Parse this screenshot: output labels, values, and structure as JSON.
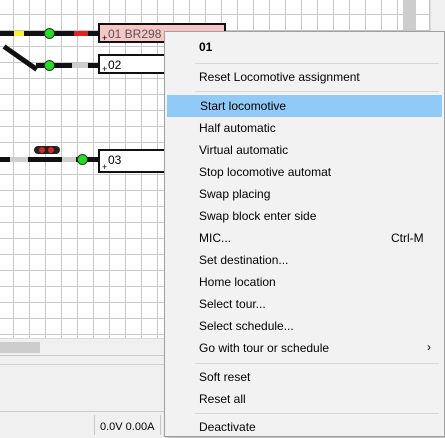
{
  "blocks": [
    {
      "id": "01",
      "label": "01 BR298",
      "plus": "+"
    },
    {
      "id": "02",
      "label": "02",
      "plus": "+"
    },
    {
      "id": "03",
      "label": "03",
      "plus": "+"
    }
  ],
  "status": {
    "voltage": "0.0V 0.00A"
  },
  "context_menu": {
    "header": "01",
    "items": [
      {
        "label": "Reset Locomotive assignment"
      },
      {
        "label": "Start locomotive",
        "highlighted": true
      },
      {
        "label": "Half automatic"
      },
      {
        "label": "Virtual automatic"
      },
      {
        "label": "Stop locomotive automat"
      },
      {
        "label": "Swap placing"
      },
      {
        "label": "Swap block enter side"
      },
      {
        "label": "MIC...",
        "shortcut": "Ctrl-M"
      },
      {
        "label": "Set destination..."
      },
      {
        "label": "Home location"
      },
      {
        "label": "Select tour..."
      },
      {
        "label": "Select schedule..."
      },
      {
        "label": "Go with tour or schedule",
        "submenu": "›"
      },
      {
        "label": "Soft reset"
      },
      {
        "label": "Reset all"
      },
      {
        "label": "Deactivate"
      }
    ]
  },
  "colors": {
    "highlight": "#91c9f7",
    "block_occupied": "#f7c6c6",
    "signal_green": "#22dd22",
    "signal_red": "#dd2222",
    "track_yellow": "#ffee33"
  }
}
